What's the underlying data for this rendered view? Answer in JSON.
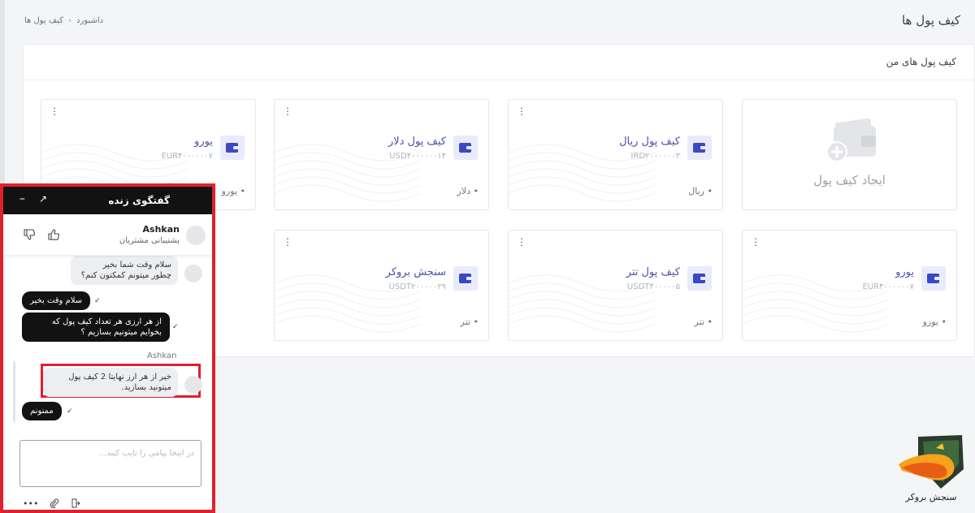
{
  "header": {
    "page_title": "کیف پول ها",
    "breadcrumb": [
      "داشبورد",
      "کیف پول ها"
    ],
    "breadcrumb_sep": "›"
  },
  "main": {
    "section_title": "کیف پول های من",
    "create_label": "ایجاد کیف پول",
    "wallets": [
      {
        "name": "کیف پول ریال",
        "number": "IRD۲۰۰۰۰۰۰۳",
        "currency": "ریال"
      },
      {
        "name": "کیف پول دلار",
        "number": "USD۴۰۰۰۰۰۰۱۴",
        "currency": "دلار"
      },
      {
        "name": "یورو",
        "number": "EUR۴۰۰۰۰۰۰۷",
        "currency": "یورو"
      },
      {
        "name": "یورو",
        "number": "EUR۴۰۰۰۰۰۰۷",
        "currency": "یورو"
      },
      {
        "name": "کیف پول تتر",
        "number": "USDT۴۰۰۰۰۰۵",
        "currency": "تتر"
      },
      {
        "name": "سنجش بروکر",
        "number": "USDT۲۰۰۰۰۰۲۹",
        "currency": "تتر"
      }
    ]
  },
  "chat": {
    "title": "گفتگوی زنده",
    "minimize": "–",
    "expand": "↗",
    "agent_name": "Ashkan",
    "agent_role": "پشتیبانی مشتریان",
    "messages": [
      {
        "from": "agent",
        "text": "سلام وقت شما بخیر\nچطور میتونم کمکتون کنم؟"
      },
      {
        "from": "user",
        "text": "سلام وقت بخیر"
      },
      {
        "from": "user",
        "text": "از هر ارزی هر تعداد کیف پول که\nبخوایم میتونیم بسازیم ؟"
      },
      {
        "from": "agent",
        "sender": "Ashkan",
        "text": "خیر از هر ارز نهایتا 2 کیف پول\nمیتونید بسازید."
      },
      {
        "from": "user",
        "text": "ممنونم"
      }
    ],
    "input_placeholder": "در اینجا پیامی را تایپ کنید...",
    "tick": "✓"
  },
  "logo": {
    "text": "سنجش بروکر"
  },
  "colors": {
    "accent": "#4a4fa8",
    "highlight": "#e0202b",
    "chat_dark": "#121212"
  }
}
